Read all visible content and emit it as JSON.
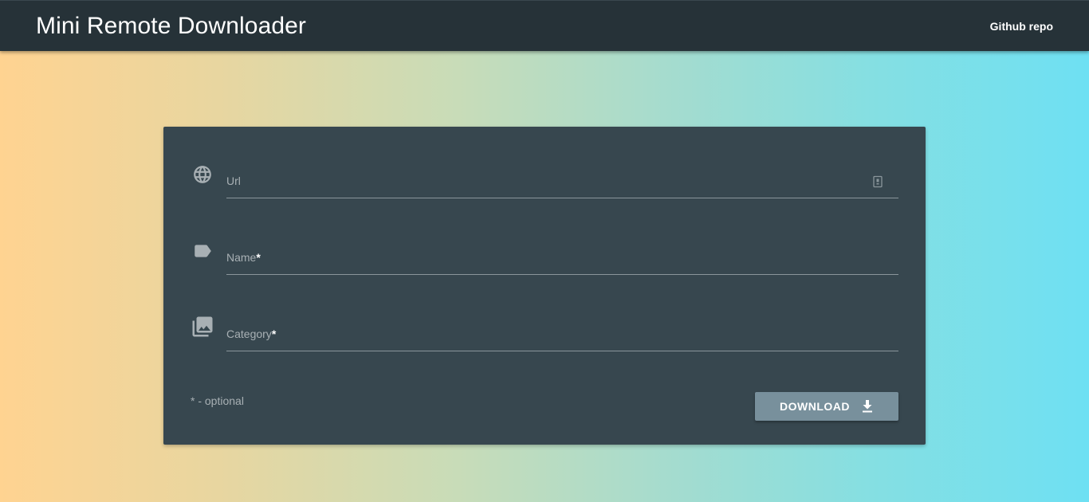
{
  "header": {
    "title": "Mini Remote Downloader",
    "github_link": "Github repo"
  },
  "form": {
    "fields": [
      {
        "label": "Url",
        "required_mark": "",
        "icon": "globe-icon",
        "trailing_icon": "clipboard-icon"
      },
      {
        "label": "Name",
        "required_mark": "*",
        "icon": "label-tag-icon"
      },
      {
        "label": "Category",
        "required_mark": "*",
        "icon": "photo-library-icon"
      }
    ],
    "optional_note": "* - optional",
    "download_button": {
      "label": "DOWNLOAD",
      "icon": "download-icon"
    }
  },
  "colors": {
    "topbar": "#263238",
    "card": "#37474f",
    "button": "#78909c",
    "gradient_start": "#ffd391",
    "gradient_end": "#6ee0f3"
  }
}
